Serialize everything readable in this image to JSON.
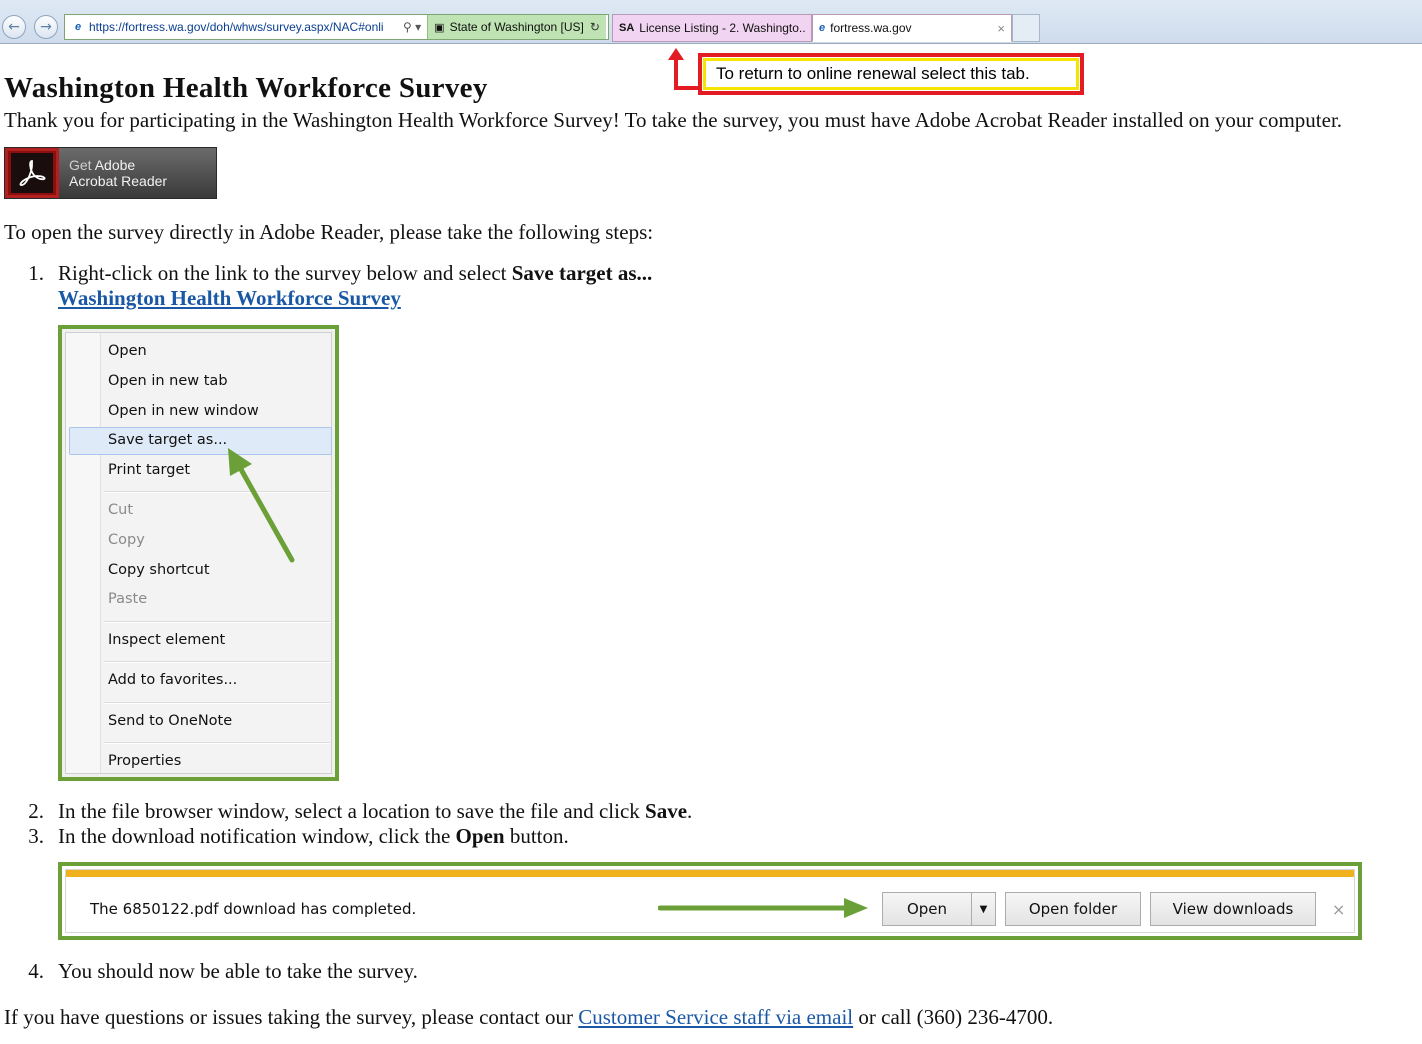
{
  "browser": {
    "url": "https://fortress.wa.gov/doh/whws/survey.aspx/NAC#onli",
    "cert_label": "State of Washington [US]",
    "tabs": [
      {
        "label": "License Listing - 2. Washingto...",
        "icon": "SA"
      },
      {
        "label": "fortress.wa.gov",
        "icon": "e"
      }
    ]
  },
  "callout": {
    "text": "To return to online renewal select this tab.",
    "border_color": "#e31b23",
    "inner_color": "#f5e400"
  },
  "page": {
    "title": "Washington Health Workforce Survey",
    "intro": "Thank you for participating in the Washington Health Workforce Survey! To take the survey, you must have Adobe Acrobat Reader installed on your computer.",
    "adobe_badge": {
      "line1_prefix": "Get",
      "line1_brand": "Adobe",
      "line2": "Acrobat Reader"
    },
    "steps_intro": "To open the survey directly in Adobe Reader, please take the following steps:",
    "steps": [
      {
        "num": "1.",
        "text": "Right-click on the link to the survey below and select ",
        "bold": "Save target as..."
      },
      {
        "num": "2.",
        "text": "In the file browser window, select a location to save the file and click ",
        "bold": "Save",
        "after": "."
      },
      {
        "num": "3.",
        "text": "In the download notification window, click the ",
        "bold": "Open",
        "after": " button."
      },
      {
        "num": "4.",
        "text": "You should now be able to take the survey."
      }
    ],
    "survey_link": "Washington Health Workforce Survey",
    "footer": {
      "before": "If you have questions or issues taking the survey, please contact our ",
      "link": "Customer Service staff via email",
      "after": " or call (360) 236-4700."
    }
  },
  "context_menu": {
    "items": [
      "Open",
      "Open in new tab",
      "Open in new window",
      "Save target as...",
      "Print target",
      "Cut",
      "Copy",
      "Copy shortcut",
      "Paste",
      "Inspect element",
      "Add to favorites...",
      "Send to OneNote",
      "Properties"
    ],
    "highlighted": "Save target as...",
    "disabled": [
      "Cut",
      "Copy",
      "Paste"
    ],
    "frame_color": "#6aa037"
  },
  "download_bar": {
    "message": "The 6850122.pdf download has completed.",
    "open_label": "Open",
    "open_folder_label": "Open folder",
    "view_downloads_label": "View downloads",
    "close_glyph": "×",
    "accent_color": "#f0b21c"
  }
}
